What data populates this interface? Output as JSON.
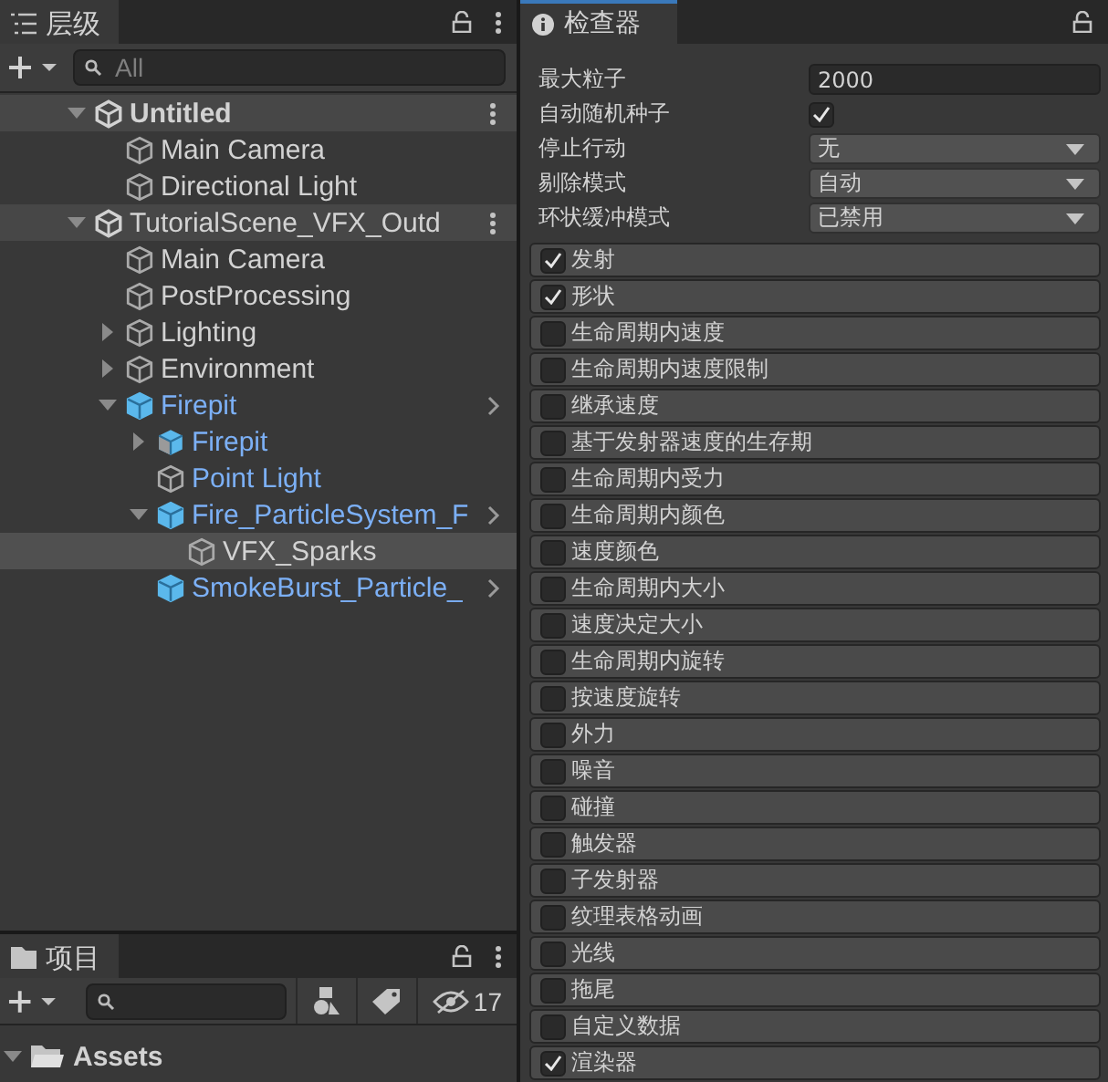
{
  "hierarchy": {
    "title": "层级",
    "search": {
      "placeholder": "All"
    },
    "items": [
      {
        "name": "Untitled",
        "kind": "scene",
        "expanded": true,
        "selected": false,
        "children": [
          {
            "name": "Main Camera",
            "kind": "object",
            "selected": false
          },
          {
            "name": "Directional Light",
            "kind": "object",
            "selected": false
          }
        ]
      },
      {
        "name": "TutorialScene_VFX_Outd",
        "kind": "scene",
        "expanded": true,
        "selected": false,
        "children": [
          {
            "name": "Main Camera",
            "kind": "object",
            "selected": false
          },
          {
            "name": "PostProcessing",
            "kind": "object",
            "selected": false
          },
          {
            "name": "Lighting",
            "kind": "object",
            "expanded": false,
            "selected": false
          },
          {
            "name": "Environment",
            "kind": "object",
            "expanded": false,
            "selected": false
          },
          {
            "name": "Firepit",
            "kind": "prefab",
            "expanded": true,
            "selected": false,
            "children": [
              {
                "name": "Firepit",
                "kind": "model",
                "expanded": false,
                "selected": false
              },
              {
                "name": "Point Light",
                "kind": "prefab_object",
                "selected": false
              },
              {
                "name": "Fire_ParticleSystem_F",
                "kind": "prefab",
                "expanded": true,
                "selected": false,
                "children": [
                  {
                    "name": "VFX_Sparks",
                    "kind": "object",
                    "selected": true
                  }
                ]
              },
              {
                "name": "SmokeBurst_Particle_",
                "kind": "prefab",
                "selected": false
              }
            ]
          }
        ]
      }
    ]
  },
  "inspector": {
    "title": "检查器",
    "fields": [
      {
        "label": "最大粒子",
        "kind": "number",
        "value": "2000"
      },
      {
        "label": "自动随机种子",
        "kind": "checkbox",
        "checked": true
      },
      {
        "label": "停止行动",
        "kind": "dropdown",
        "value": "无"
      },
      {
        "label": "剔除模式",
        "kind": "dropdown",
        "value": "自动"
      },
      {
        "label": "环状缓冲模式",
        "kind": "dropdown",
        "value": "已禁用"
      }
    ],
    "modules": [
      {
        "label": "发射",
        "checked": true
      },
      {
        "label": "形状",
        "checked": true
      },
      {
        "label": "生命周期内速度",
        "checked": false
      },
      {
        "label": "生命周期内速度限制",
        "checked": false
      },
      {
        "label": "继承速度",
        "checked": false
      },
      {
        "label": "基于发射器速度的生存期",
        "checked": false
      },
      {
        "label": "生命周期内受力",
        "checked": false
      },
      {
        "label": "生命周期内颜色",
        "checked": false
      },
      {
        "label": "速度颜色",
        "checked": false
      },
      {
        "label": "生命周期内大小",
        "checked": false
      },
      {
        "label": "速度决定大小",
        "checked": false
      },
      {
        "label": "生命周期内旋转",
        "checked": false
      },
      {
        "label": "按速度旋转",
        "checked": false
      },
      {
        "label": "外力",
        "checked": false
      },
      {
        "label": "噪音",
        "checked": false
      },
      {
        "label": "碰撞",
        "checked": false
      },
      {
        "label": "触发器",
        "checked": false
      },
      {
        "label": "子发射器",
        "checked": false
      },
      {
        "label": "纹理表格动画",
        "checked": false
      },
      {
        "label": "光线",
        "checked": false
      },
      {
        "label": "拖尾",
        "checked": false
      },
      {
        "label": "自定义数据",
        "checked": false
      },
      {
        "label": "渲染器",
        "checked": true
      }
    ]
  },
  "project": {
    "title": "项目",
    "hidden_count": "17",
    "items": [
      {
        "name": "Assets",
        "expanded": true
      }
    ]
  }
}
